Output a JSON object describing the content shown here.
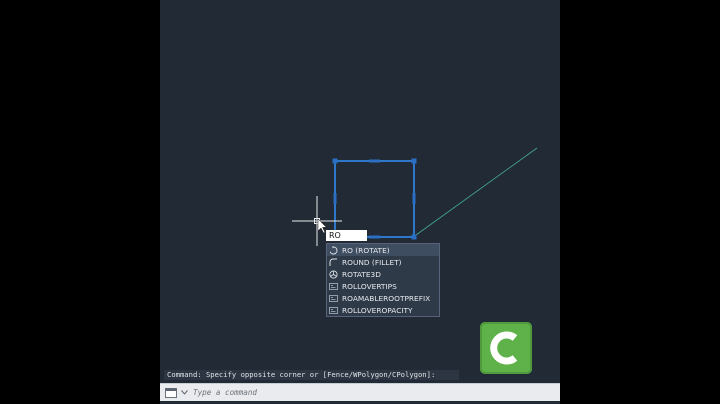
{
  "dynamic_input": {
    "value": "RO"
  },
  "autocomplete": {
    "items": [
      {
        "label": "RO (ROTATE)",
        "icon": "rotate-icon"
      },
      {
        "label": "ROUND (FILLET)",
        "icon": "fillet-icon"
      },
      {
        "label": "ROTATE3D",
        "icon": "rotate3d-icon"
      },
      {
        "label": "ROLLOVERTIPS",
        "icon": "system-variable-icon"
      },
      {
        "label": "ROAMABLEROOTPREFIX",
        "icon": "system-variable-icon"
      },
      {
        "label": "ROLLOVEROPACITY",
        "icon": "system-variable-icon"
      }
    ]
  },
  "command": {
    "history": "Command: Specify opposite corner or [Fence/WPolygon/CPolygon]:",
    "placeholder": "Type a command"
  },
  "colors": {
    "canvas": "#222a35",
    "selection_blue": "#2f77c8",
    "logo_green": "#5fb14a"
  },
  "watermark": {
    "name": "camtasia-logo"
  }
}
